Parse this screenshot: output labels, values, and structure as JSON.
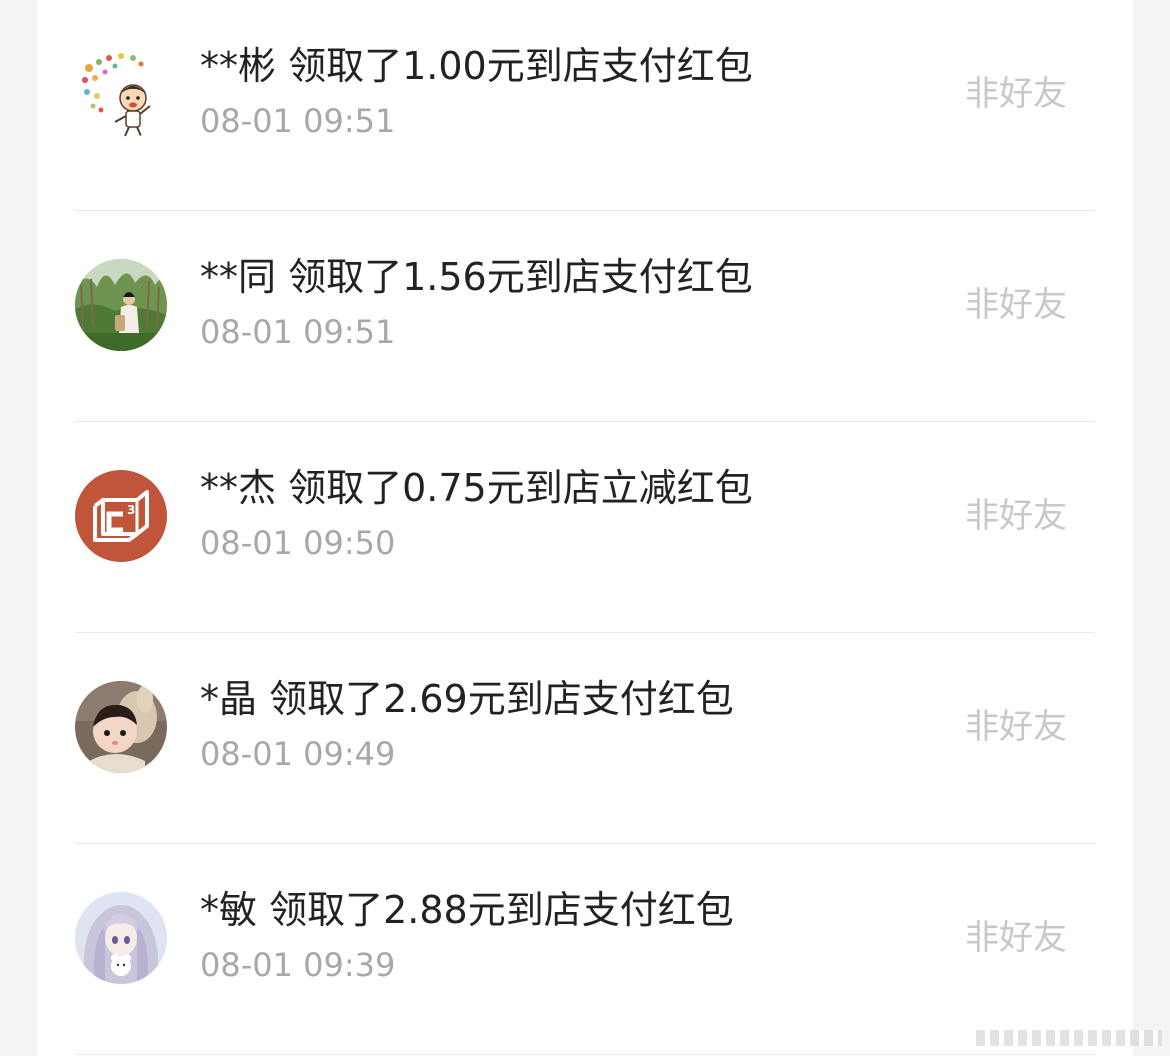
{
  "records": [
    {
      "name": "**彬",
      "action": "领取了1.00元到店支付红包",
      "time": "08-01 09:51",
      "status": "非好友",
      "avatar": "cartoon-boy-avatar-icon"
    },
    {
      "name": "**同",
      "action": "领取了1.56元到店支付红包",
      "time": "08-01 09:51",
      "status": "非好友",
      "avatar": "outdoor-photo-avatar-icon"
    },
    {
      "name": "**杰",
      "action": "领取了0.75元到店立减红包",
      "time": "08-01 09:50",
      "status": "非好友",
      "avatar": "c3-logo-avatar-icon"
    },
    {
      "name": "*晶",
      "action": "领取了2.69元到店支付红包",
      "time": "08-01 09:49",
      "status": "非好友",
      "avatar": "baby-photo-avatar-icon"
    },
    {
      "name": "*敏",
      "action": "领取了2.88元到店支付红包",
      "time": "08-01 09:39",
      "status": "非好友",
      "avatar": "anime-girl-avatar-icon"
    }
  ],
  "colors": {
    "title": "#222222",
    "time": "#a8a8a8",
    "status": "#c8c8c8",
    "divider": "#e9e9e9",
    "c3_logo": "#c0553a"
  }
}
